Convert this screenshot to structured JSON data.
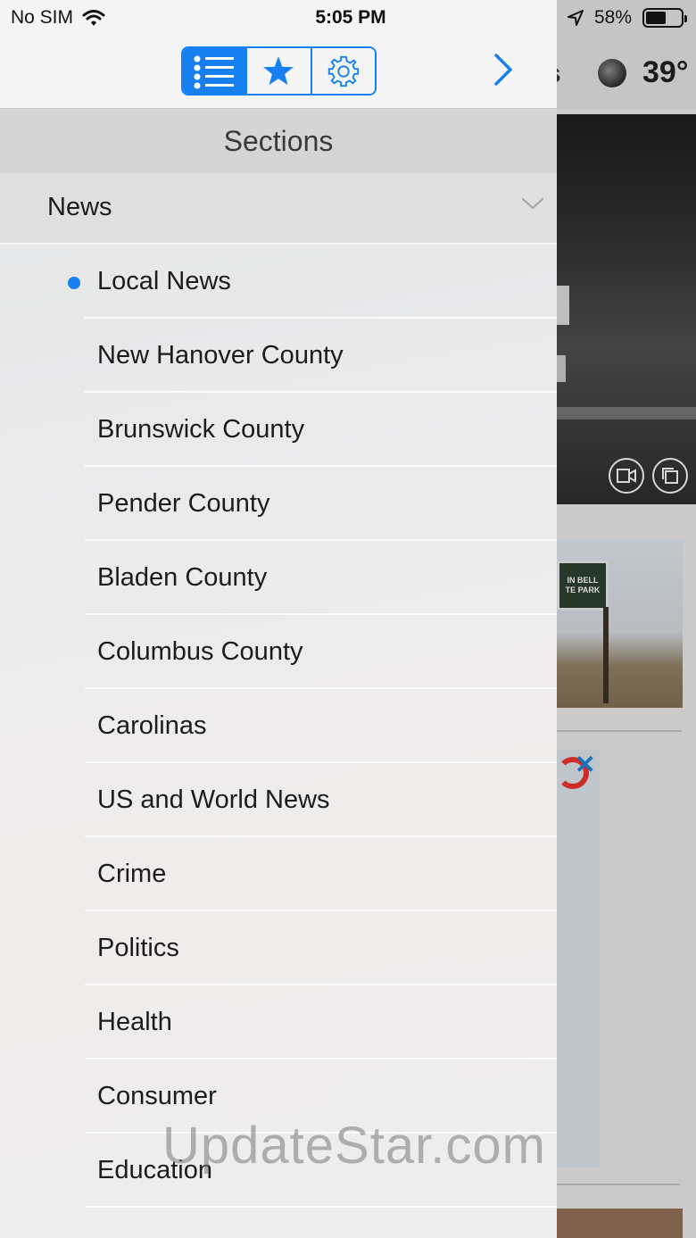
{
  "status_bar": {
    "carrier": "No SIM",
    "time": "5:05 PM",
    "battery_percent": "58%",
    "battery_level": 0.58
  },
  "toolbar": {
    "segments": [
      {
        "icon": "list-icon",
        "selected": true
      },
      {
        "icon": "star-icon",
        "selected": false
      },
      {
        "icon": "gear-icon",
        "selected": false
      }
    ],
    "next_icon": "chevron-right-icon",
    "accent_color": "#1680f0"
  },
  "drawer": {
    "title": "Sections",
    "group": {
      "label": "News",
      "icon": "chevron-down-icon"
    },
    "items": [
      {
        "label": "Local News",
        "selected": true
      },
      {
        "label": "New Hanover County"
      },
      {
        "label": "Brunswick County"
      },
      {
        "label": "Pender County"
      },
      {
        "label": "Bladen County"
      },
      {
        "label": "Columbus County"
      },
      {
        "label": "Carolinas"
      },
      {
        "label": "US and World News"
      },
      {
        "label": "Crime"
      },
      {
        "label": "Politics"
      },
      {
        "label": "Health"
      },
      {
        "label": "Consumer"
      },
      {
        "label": "Education"
      }
    ]
  },
  "background": {
    "header_partial": "s",
    "temperature": "39°",
    "sign_text": "IN BELL\nTE PARK"
  },
  "watermark": "UpdateStar.com"
}
